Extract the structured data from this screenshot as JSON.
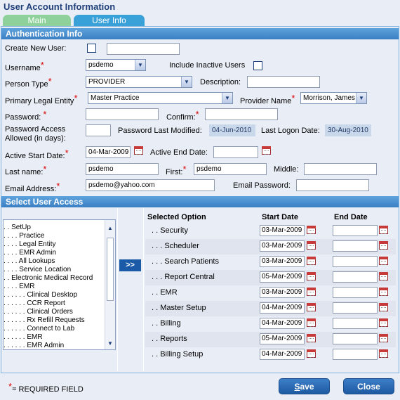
{
  "page_title": "User Account Information",
  "tabs": [
    {
      "label": "Main"
    },
    {
      "label": "User Info"
    }
  ],
  "auth": {
    "section_title": "Authentication Info",
    "create_new_user_label": "Create New User:",
    "create_new_user_value": "",
    "username_label": "Username",
    "username_value": "psdemo",
    "include_inactive_label": "Include Inactive Users",
    "person_type_label": "Person Type",
    "person_type_value": "PROVIDER",
    "description_label": "Description:",
    "description_value": "",
    "primary_legal_entity_label": "Primary Legal Entity",
    "primary_legal_entity_value": "Master Practice",
    "provider_name_label": "Provider Name",
    "provider_name_value": "Morrison, James",
    "password_label": "Password:",
    "password_value": "",
    "confirm_label": "Confirm:",
    "confirm_value": "",
    "password_access_label_1": "Password Access",
    "password_access_label_2": "Allowed (in days):",
    "password_access_value": "",
    "password_last_modified_label": "Password Last Modified:",
    "password_last_modified_value": "04-Jun-2010",
    "last_logon_label": "Last Logon Date:",
    "last_logon_value": "30-Aug-2010",
    "active_start_label": "Active Start Date:",
    "active_start_value": "04-Mar-2009",
    "active_end_label": "Active End Date:",
    "active_end_value": "",
    "last_name_label": "Last name:",
    "last_name_value": "psdemo",
    "first_label": "First:",
    "first_value": "psdemo",
    "middle_label": "Middle:",
    "middle_value": "",
    "email_label": "Email Address:",
    "email_value": "psdemo@yahoo.com",
    "email_password_label": "Email Password:",
    "email_password_value": ""
  },
  "access": {
    "section_title": "Select User Access",
    "tree_items": [
      ". . SetUp",
      ". . . . Practice",
      ". . . . Legal Entity",
      ". . . . EMR Admin",
      ". . . . All Lookups",
      ". . . . Service Location",
      ". . Electronic Medical Record",
      ". . . . EMR",
      ". . . . . . Clinical Desktop",
      ". . . . . . CCR Report",
      ". . . . . . Clinical Orders",
      ". . . . . . Rx Refill Requests",
      ". . . . . . Connect to Lab",
      ". . . . . . EMR",
      ". . . . . . EMR Admin"
    ],
    "move_label": ">>",
    "columns": {
      "option": "Selected Option",
      "start": "Start Date",
      "end": "End Date"
    },
    "rows": [
      {
        "option": ". . Security",
        "start": "03-Mar-2009",
        "end": ""
      },
      {
        "option": ". . . Scheduler",
        "start": "03-Mar-2009",
        "end": ""
      },
      {
        "option": ". . . Search Patients",
        "start": "03-Mar-2009",
        "end": ""
      },
      {
        "option": ". . . Report Central",
        "start": "05-Mar-2009",
        "end": ""
      },
      {
        "option": ". . EMR",
        "start": "03-Mar-2009",
        "end": ""
      },
      {
        "option": ". . Master Setup",
        "start": "04-Mar-2009",
        "end": ""
      },
      {
        "option": ". . Billing",
        "start": "04-Mar-2009",
        "end": ""
      },
      {
        "option": ". . Reports",
        "start": "05-Mar-2009",
        "end": ""
      },
      {
        "option": ". . Billing Setup",
        "start": "04-Mar-2009",
        "end": ""
      }
    ]
  },
  "footer": {
    "required_marker": "*",
    "required_text": "= REQUIRED FIELD",
    "save_label_first": "S",
    "save_label_rest": "ave",
    "close_label": "Close"
  },
  "colors": {
    "accent": "#3b7fc4",
    "required": "#dd0000",
    "tab_main": "#8fd19a",
    "tab_user": "#3aa0d8"
  }
}
